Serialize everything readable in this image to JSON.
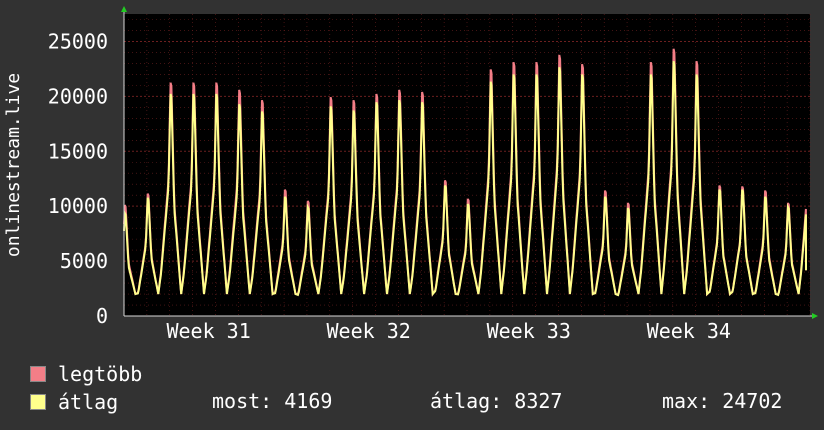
{
  "colors": {
    "background": "#323232",
    "plot": "#000000",
    "grid": "#6b1f1f",
    "axis": "#d8d8d8",
    "max": "#f37e87",
    "avg": "#ffff8c",
    "arrow": "#22cc22"
  },
  "legend": [
    {
      "label": "legtöbb",
      "color": "#f37e87"
    },
    {
      "label": "átlag",
      "color": "#ffff8c"
    }
  ],
  "stats": {
    "now": "most: 4169",
    "avg": "átlag: 8327",
    "max": "max: 24702"
  },
  "chart_data": {
    "type": "line",
    "ylabel": "onlinestream.live",
    "ylim": [
      0,
      27500
    ],
    "yticks": [
      0,
      5000,
      10000,
      15000,
      20000,
      25000
    ],
    "x_tick_labels": [
      "Week 31",
      "Week 32",
      "Week 33",
      "Week 34"
    ],
    "grid": true,
    "days": 30,
    "series": [
      {
        "name": "legtöbb",
        "daily_peaks": [
          10800,
          11900,
          22700,
          22700,
          22700,
          22000,
          21000,
          12300,
          11200,
          21300,
          21000,
          21600,
          22000,
          21800,
          13200,
          11400,
          24000,
          24700,
          24700,
          25400,
          24500,
          12200,
          11000,
          24700,
          26000,
          24800,
          12700,
          12600,
          12200,
          11000,
          24000
        ]
      },
      {
        "name": "átlag",
        "daily_peaks": [
          10000,
          11500,
          21600,
          21600,
          21600,
          20600,
          19900,
          11600,
          10600,
          20400,
          20000,
          20800,
          21000,
          20800,
          12700,
          10900,
          22800,
          23500,
          23500,
          24200,
          23500,
          11600,
          10500,
          23500,
          24800,
          23500,
          12300,
          12300,
          11600,
          10600,
          22800
        ]
      }
    ],
    "daily_min": 2000,
    "last_value": 4169
  }
}
